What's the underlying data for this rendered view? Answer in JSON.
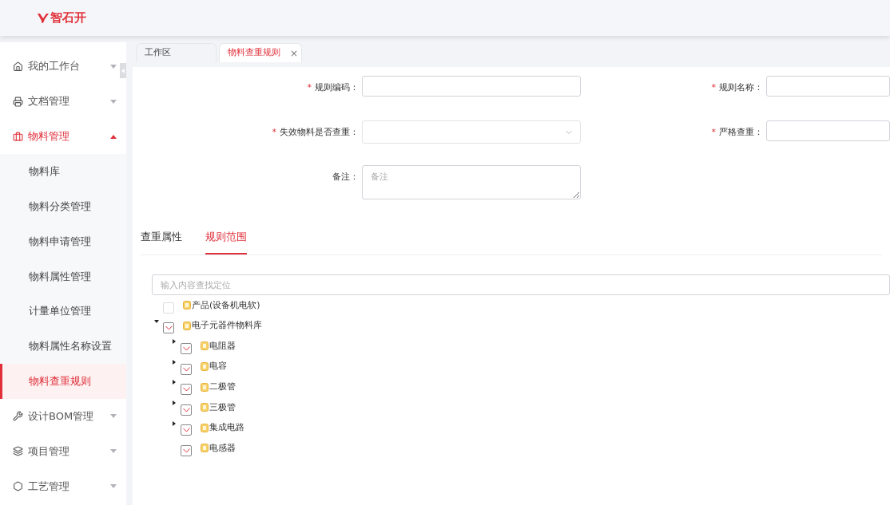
{
  "logo": {
    "text": "智石开"
  },
  "sidebar": {
    "items": [
      {
        "label": "我的工作台",
        "expanded": false
      },
      {
        "label": "文档管理",
        "expanded": false
      },
      {
        "label": "物料管理",
        "expanded": true,
        "children": [
          {
            "label": "物料库",
            "selected": false
          },
          {
            "label": "物料分类管理",
            "selected": false
          },
          {
            "label": "物料申请管理",
            "selected": false
          },
          {
            "label": "物料属性管理",
            "selected": false
          },
          {
            "label": "计量单位管理",
            "selected": false
          },
          {
            "label": "物料属性名称设置",
            "selected": false
          },
          {
            "label": "物料查重规则",
            "selected": true
          }
        ]
      },
      {
        "label": "设计BOM管理",
        "expanded": false
      },
      {
        "label": "项目管理",
        "expanded": false
      },
      {
        "label": "工艺管理",
        "expanded": false
      }
    ]
  },
  "tabs": [
    {
      "label": "工作区",
      "selected": false
    },
    {
      "label": "物料查重规则",
      "selected": true,
      "close_mark": "×"
    }
  ],
  "form": {
    "fields": [
      {
        "label": "规则编码：",
        "kind": "input",
        "required_mark": "*"
      },
      {
        "label": "规则名称：",
        "kind": "input",
        "required_mark": "*"
      },
      {
        "label": "失效物料是否查重：",
        "kind": "select",
        "required_mark": "*"
      },
      {
        "label": "严格查重：",
        "kind": "input",
        "required_mark": "*"
      },
      {
        "label": "备注：",
        "kind": "textarea",
        "placeholder": "备注"
      }
    ]
  },
  "section_tabs": [
    {
      "label": "查重属性",
      "selected": false
    },
    {
      "label": "规则范围",
      "selected": true
    }
  ],
  "tree": {
    "search": {
      "placeholder": "输入内容查找定位"
    },
    "nodes": [
      {
        "label": "产品(设备机电软)",
        "checked": false
      },
      {
        "label": "电子元器件物料库",
        "checked": true,
        "expanded": true,
        "children": [
          {
            "label": "电阻器",
            "checked": true,
            "expanded": false
          },
          {
            "label": "电容",
            "checked": true,
            "expanded": false
          },
          {
            "label": "二极管",
            "checked": true,
            "expanded": false
          },
          {
            "label": "三极管",
            "checked": true,
            "expanded": false
          },
          {
            "label": "集成电路",
            "checked": true,
            "expanded": false
          },
          {
            "label": "电感器",
            "checked": true
          }
        ]
      }
    ]
  }
}
